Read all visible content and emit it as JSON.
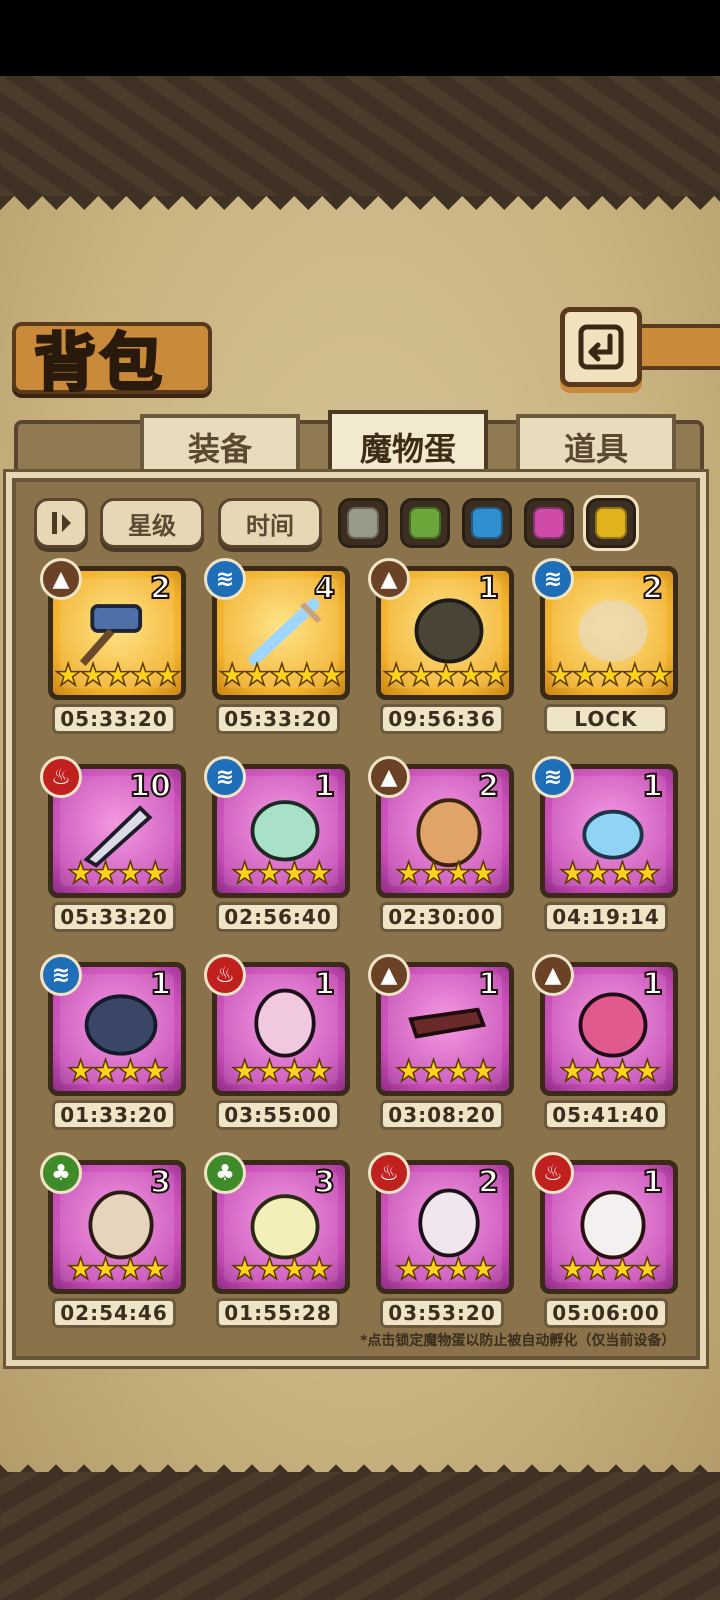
{
  "header": {
    "title": "背包",
    "back_icon": "back-arrow-icon"
  },
  "tabs": [
    {
      "label": "装备",
      "active": false
    },
    {
      "label": "魔物蛋",
      "active": true
    },
    {
      "label": "道具",
      "active": false
    }
  ],
  "filters": {
    "sort_icon": "sort-toggle-icon",
    "star_label": "星级",
    "time_label": "时间",
    "colors": [
      "#9a9a8a",
      "#6aa63a",
      "#2f8fd0",
      "#d04aa8",
      "#e2b21c"
    ],
    "selected_color_index": 4
  },
  "items": [
    {
      "element": "earth",
      "frame": "gold",
      "count": "2",
      "stars": "★★★★★",
      "timer": "05:33:20"
    },
    {
      "element": "water",
      "frame": "gold",
      "count": "4",
      "stars": "★★★★★",
      "timer": "05:33:20"
    },
    {
      "element": "earth",
      "frame": "gold",
      "count": "1",
      "stars": "★★★★★",
      "timer": "09:56:36"
    },
    {
      "element": "water",
      "frame": "gold",
      "count": "2",
      "stars": "★★★★★",
      "timer": "LOCK"
    },
    {
      "element": "fire",
      "frame": "purple",
      "count": "10",
      "stars": "★★★★",
      "timer": "05:33:20"
    },
    {
      "element": "water",
      "frame": "purple",
      "count": "1",
      "stars": "★★★★",
      "timer": "02:56:40"
    },
    {
      "element": "earth",
      "frame": "purple",
      "count": "2",
      "stars": "★★★★",
      "timer": "02:30:00"
    },
    {
      "element": "water",
      "frame": "purple",
      "count": "1",
      "stars": "★★★★",
      "timer": "04:19:14"
    },
    {
      "element": "water",
      "frame": "purple",
      "count": "1",
      "stars": "★★★★",
      "timer": "01:33:20"
    },
    {
      "element": "fire",
      "frame": "purple",
      "count": "1",
      "stars": "★★★★",
      "timer": "03:55:00"
    },
    {
      "element": "earth",
      "frame": "purple",
      "count": "1",
      "stars": "★★★★",
      "timer": "03:08:20"
    },
    {
      "element": "earth",
      "frame": "purple",
      "count": "1",
      "stars": "★★★★",
      "timer": "05:41:40"
    },
    {
      "element": "nature",
      "frame": "purple",
      "count": "3",
      "stars": "★★★★",
      "timer": "02:54:46"
    },
    {
      "element": "nature",
      "frame": "purple",
      "count": "3",
      "stars": "★★★★",
      "timer": "01:55:28"
    },
    {
      "element": "fire",
      "frame": "purple",
      "count": "2",
      "stars": "★★★★",
      "timer": "03:53:20"
    },
    {
      "element": "fire",
      "frame": "purple",
      "count": "1",
      "stars": "★★★★",
      "timer": "05:06:00"
    }
  ],
  "footnote": "*点击锁定魔物蛋以防止被自动孵化（仅当前设备）"
}
